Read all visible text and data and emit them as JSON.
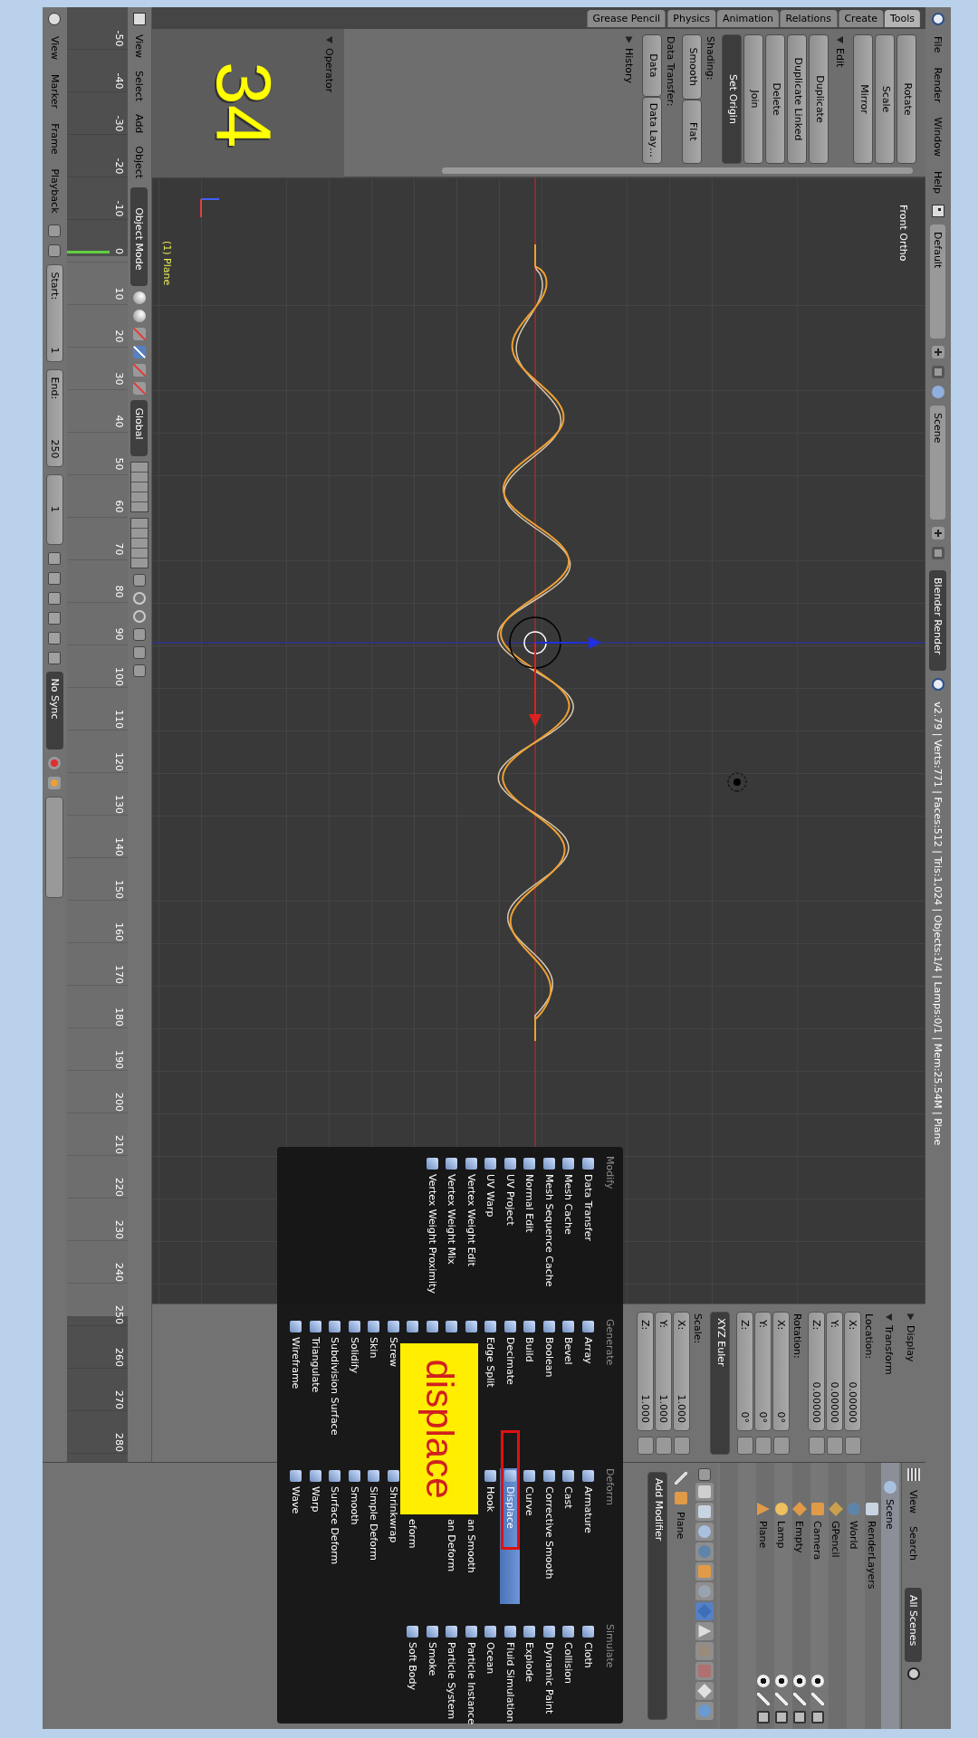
{
  "info_header": {
    "menus": [
      "File",
      "Render",
      "Window",
      "Help"
    ],
    "layout": "Default",
    "scene": "Scene",
    "engine": "Blender Render",
    "stats": "v2.79 | Verts:771 | Faces:512 | Tris:1,024 | Objects:1/4 | Lamps:0/1 | Mem:25.54M | Plane"
  },
  "tool_shelf": {
    "tabs": [
      {
        "label": "Grease Pencil",
        "selected": false
      },
      {
        "label": "Physics",
        "selected": false
      },
      {
        "label": "Animation",
        "selected": false
      },
      {
        "label": "Relations",
        "selected": false
      },
      {
        "label": "Create",
        "selected": false
      },
      {
        "label": "Tools",
        "selected": true
      }
    ],
    "items": [
      {
        "kind": "button",
        "label": "Rotate"
      },
      {
        "kind": "button",
        "label": "Scale"
      },
      {
        "kind": "button",
        "label": "Mirror"
      },
      {
        "kind": "header",
        "label": "Edit",
        "expanded": true
      },
      {
        "kind": "button",
        "label": "Duplicate"
      },
      {
        "kind": "button",
        "label": "Duplicate Linked"
      },
      {
        "kind": "button",
        "label": "Delete"
      },
      {
        "kind": "button",
        "label": "Join"
      },
      {
        "kind": "dropdown",
        "label": "Set Origin"
      },
      {
        "kind": "label",
        "label": "Shading:"
      },
      {
        "kind": "pair",
        "labels": [
          "Smooth",
          "Flat"
        ]
      },
      {
        "kind": "label",
        "label": "Data Transfer:"
      },
      {
        "kind": "pair",
        "labels": [
          "Data",
          "Data Lay…"
        ]
      },
      {
        "kind": "header",
        "label": "History",
        "expanded": false
      }
    ]
  },
  "operator": {
    "title": "Operator",
    "expanded": true,
    "step_number": "34"
  },
  "viewport": {
    "view_label": "Front Ortho",
    "object_label": "(1) Plane"
  },
  "n_panel": {
    "panels": [
      {
        "title": "Display",
        "expanded": false
      },
      {
        "title": "Transform",
        "expanded": true
      }
    ],
    "groups": [
      {
        "label": "Location:",
        "fields": [
          {
            "axis": "X:",
            "value": "0.00000"
          },
          {
            "axis": "Y:",
            "value": "0.00000"
          },
          {
            "axis": "Z:",
            "value": "0.00000"
          }
        ]
      },
      {
        "label": "Rotation:",
        "fields": [
          {
            "axis": "X:",
            "value": "0°"
          },
          {
            "axis": "Y:",
            "value": "0°"
          },
          {
            "axis": "Z:",
            "value": "0°"
          }
        ]
      }
    ],
    "rotation_mode": "XYZ Euler",
    "scale": {
      "label": "Scale:",
      "fields": [
        {
          "axis": "X:",
          "value": "1.000"
        },
        {
          "axis": "Y:",
          "value": "1.000"
        },
        {
          "axis": "Z:",
          "value": "1.000"
        }
      ]
    }
  },
  "viewport_header": {
    "menus": [
      "View",
      "Select",
      "Add",
      "Object"
    ],
    "mode": "Object Mode",
    "orientation": "Global"
  },
  "timeline": {
    "ticks": [
      "-50",
      "-40",
      "-30",
      "-20",
      "-10",
      "0",
      "10",
      "20",
      "30",
      "40",
      "50",
      "60",
      "70",
      "80",
      "90",
      "100",
      "110",
      "120",
      "130",
      "140",
      "150",
      "160",
      "170",
      "180",
      "190",
      "200",
      "210",
      "220",
      "230",
      "240",
      "250",
      "260",
      "270",
      "280"
    ],
    "menus": [
      "View",
      "Marker",
      "Frame",
      "Playback"
    ],
    "start": {
      "label": "Start:",
      "value": "1"
    },
    "end": {
      "label": "End:",
      "value": "250"
    },
    "current": "1",
    "sync": "No Sync"
  },
  "outliner": {
    "menus": [
      "View",
      "Search"
    ],
    "filter": "All Scenes",
    "tree": [
      {
        "label": "Scene",
        "kind": "scene",
        "children": [
          {
            "label": "RenderLayers",
            "kind": "renderlayers"
          },
          {
            "label": "World",
            "kind": "world"
          },
          {
            "label": "GPencil",
            "kind": "gpencil"
          },
          {
            "label": "Camera",
            "kind": "camera"
          },
          {
            "label": "Empty",
            "kind": "empty"
          },
          {
            "label": "Lamp",
            "kind": "lamp"
          },
          {
            "label": "Plane",
            "kind": "mesh"
          }
        ]
      }
    ]
  },
  "properties": {
    "tabs": [
      {
        "kind": "render",
        "selected": false
      },
      {
        "kind": "renderlayers",
        "selected": false
      },
      {
        "kind": "scene",
        "selected": false
      },
      {
        "kind": "world",
        "selected": false
      },
      {
        "kind": "object",
        "selected": false
      },
      {
        "kind": "constraints",
        "selected": false
      },
      {
        "kind": "modifiers",
        "selected": true
      },
      {
        "kind": "data",
        "selected": false
      },
      {
        "kind": "material",
        "selected": false
      },
      {
        "kind": "texture",
        "selected": false
      },
      {
        "kind": "particles",
        "selected": false
      },
      {
        "kind": "physics",
        "selected": false
      }
    ],
    "object_name": "Plane",
    "add_modifier": "Add Modifier"
  },
  "modifier_menu": {
    "columns": [
      {
        "title": "Modify",
        "items": [
          {
            "kind": "item",
            "label": "Data Transfer",
            "selected": false
          },
          {
            "kind": "item",
            "label": "Mesh Cache",
            "selected": false
          },
          {
            "kind": "item",
            "label": "Mesh Sequence Cache",
            "selected": false
          },
          {
            "kind": "item",
            "label": "Normal Edit",
            "selected": false
          },
          {
            "kind": "item",
            "label": "UV Project",
            "selected": false
          },
          {
            "kind": "item",
            "label": "UV Warp",
            "selected": false
          },
          {
            "kind": "item",
            "label": "Vertex Weight Edit",
            "selected": false
          },
          {
            "kind": "item",
            "label": "Vertex Weight Mix",
            "selected": false
          },
          {
            "kind": "item",
            "label": "Vertex Weight Proximity",
            "selected": false
          }
        ]
      },
      {
        "title": "Generate",
        "items": [
          {
            "kind": "item",
            "label": "Array",
            "selected": false
          },
          {
            "kind": "item",
            "label": "Bevel",
            "selected": false
          },
          {
            "kind": "item",
            "label": "Boolean",
            "selected": false
          },
          {
            "kind": "item",
            "label": "Build",
            "selected": false
          },
          {
            "kind": "item",
            "label": "Decimate",
            "selected": false
          },
          {
            "kind": "item",
            "label": "Edge Split",
            "selected": false
          },
          {
            "kind": "hidden"
          },
          {
            "kind": "hidden"
          },
          {
            "kind": "hidden"
          },
          {
            "kind": "hidden"
          },
          {
            "kind": "item",
            "label": "Screw",
            "selected": false
          },
          {
            "kind": "item",
            "label": "Skin",
            "selected": false
          },
          {
            "kind": "item",
            "label": "Solidify",
            "selected": false
          },
          {
            "kind": "item",
            "label": "Subdivision Surface",
            "selected": false
          },
          {
            "kind": "item",
            "label": "Triangulate",
            "selected": false
          },
          {
            "kind": "item",
            "label": "Wireframe",
            "selected": false
          }
        ]
      },
      {
        "title": "Deform",
        "items": [
          {
            "kind": "item",
            "label": "Armature",
            "selected": false
          },
          {
            "kind": "item",
            "label": "Cast",
            "selected": false
          },
          {
            "kind": "item",
            "label": "Corrective Smooth",
            "selected": false
          },
          {
            "kind": "item",
            "label": "Curve",
            "selected": false
          },
          {
            "kind": "item",
            "label": "Displace",
            "selected": true
          },
          {
            "kind": "item",
            "label": "Hook",
            "selected": false
          },
          {
            "kind": "cut",
            "label": "an Smooth",
            "selected": false
          },
          {
            "kind": "cut",
            "label": "an Deform",
            "selected": false
          },
          {
            "kind": "hidden"
          },
          {
            "kind": "cut",
            "label": "eform",
            "selected": false
          },
          {
            "kind": "item",
            "label": "Shrinkwrap",
            "selected": false
          },
          {
            "kind": "item",
            "label": "Simple Deform",
            "selected": false
          },
          {
            "kind": "item",
            "label": "Smooth",
            "selected": false
          },
          {
            "kind": "item",
            "label": "Surface Deform",
            "selected": false
          },
          {
            "kind": "item",
            "label": "Warp",
            "selected": false
          },
          {
            "kind": "item",
            "label": "Wave",
            "selected": false
          }
        ]
      },
      {
        "title": "Simulate",
        "items": [
          {
            "kind": "item",
            "label": "Cloth",
            "selected": false
          },
          {
            "kind": "item",
            "label": "Collision",
            "selected": false
          },
          {
            "kind": "item",
            "label": "Dynamic Paint",
            "selected": false
          },
          {
            "kind": "item",
            "label": "Explode",
            "selected": false
          },
          {
            "kind": "item",
            "label": "Fluid Simulation",
            "selected": false
          },
          {
            "kind": "item",
            "label": "Ocean",
            "selected": false
          },
          {
            "kind": "item",
            "label": "Particle Instance",
            "selected": false
          },
          {
            "kind": "item",
            "label": "Particle System",
            "selected": false
          },
          {
            "kind": "item",
            "label": "Smoke",
            "selected": false
          },
          {
            "kind": "item",
            "label": "Soft Body",
            "selected": false
          }
        ]
      }
    ],
    "sticker": "displace"
  }
}
